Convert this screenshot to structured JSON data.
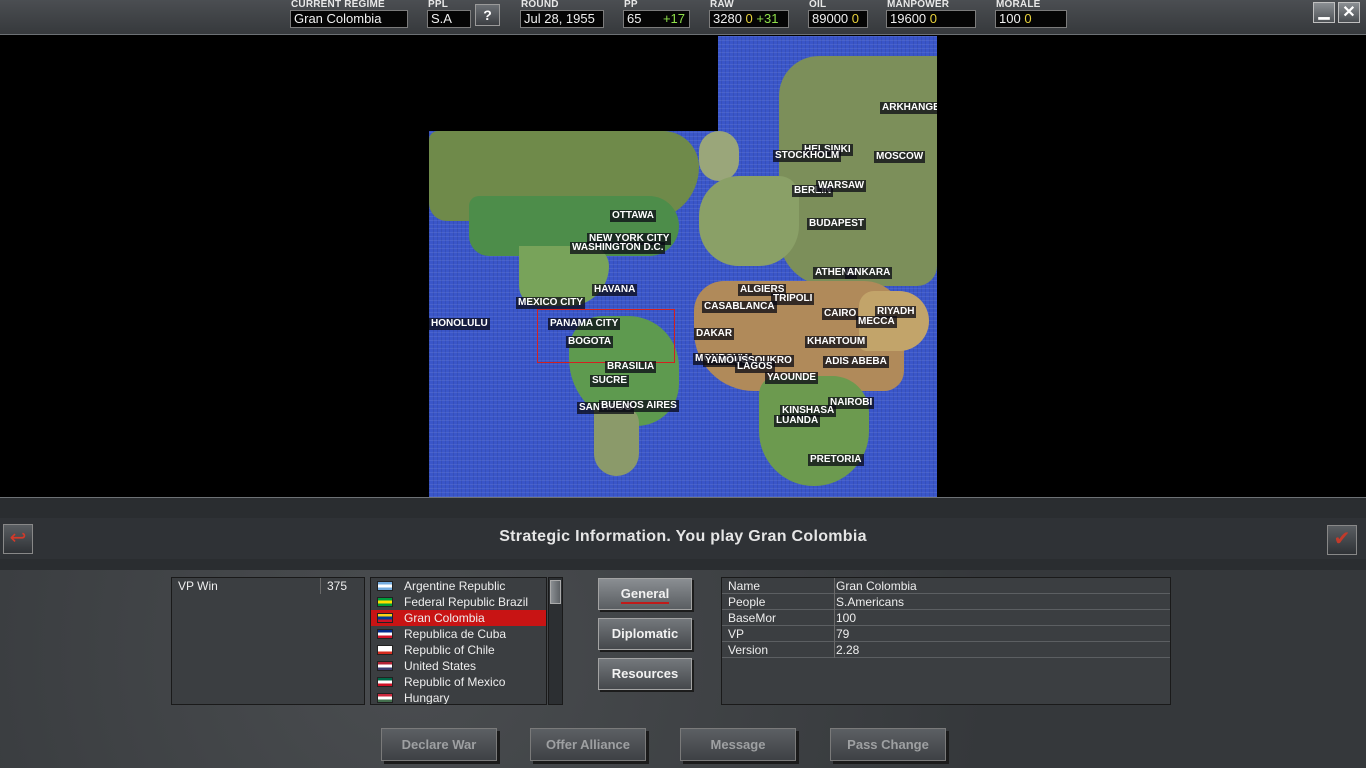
{
  "topbar": {
    "regime_label": "CURRENT REGIME",
    "regime_value": "Gran Colombia",
    "ppl_label": "PPL",
    "ppl_value": "S.A",
    "help_label": "?",
    "round_label": "ROUND",
    "round_value": "Jul 28, 1955",
    "pp_label": "PP",
    "pp_value": "65",
    "pp_delta": "+17",
    "raw_label": "RAW",
    "raw_value": "3280",
    "raw_extra": "0",
    "raw_delta": "+31",
    "oil_label": "OIL",
    "oil_value": "89000",
    "oil_extra": "0",
    "manpower_label": "MANPOWER",
    "manpower_value": "19600",
    "manpower_extra": "0",
    "morale_label": "MORALE",
    "morale_value": "100",
    "morale_extra": "0",
    "minimize_icon": "minimize-icon",
    "close_icon": "close-icon"
  },
  "map": {
    "cities": [
      "ARKHANGELSK",
      "HELSINKI",
      "STOCKHOLM",
      "MOSCOW",
      "BERLIN",
      "WARSAW",
      "BUDAPEST",
      "OTTAWA",
      "NEW YORK CITY",
      "WASHINGTON D.C.",
      "ATHENS",
      "ANKARA",
      "HAVANA",
      "ALGIERS",
      "TRIPOLI",
      "MEXICO CITY",
      "CASABLANCA",
      "CAIRO",
      "RIYADH",
      "HONOLULU",
      "PANAMA CITY",
      "MECCA",
      "DAKAR",
      "BOGOTA",
      "KHARTOUM",
      "MONROVIA",
      "YAMOUSSOUKRO",
      "LAGOS",
      "ADIS ABEBA",
      "BRASILIA",
      "YAOUNDE",
      "SUCRE",
      "NAIROBI",
      "SANTIAGO",
      "BUENOS AIRES",
      "KINSHASA",
      "LUANDA",
      "PRETORIA"
    ]
  },
  "banner": {
    "title": "Strategic Information. You play Gran Colombia",
    "back_icon": "undo-arrow-icon",
    "ok_icon": "checkmark-icon"
  },
  "vp": {
    "label": "VP Win",
    "value": "375"
  },
  "regimes": [
    {
      "name": "Argentine Republic",
      "flag": [
        "#74acdf",
        "#ffffff",
        "#74acdf"
      ]
    },
    {
      "name": "Federal Republic Brazil",
      "flag": [
        "#009c3b",
        "#ffdf00",
        "#009c3b"
      ]
    },
    {
      "name": "Gran Colombia",
      "flag": [
        "#fcd116",
        "#003893",
        "#ce1126"
      ],
      "selected": true
    },
    {
      "name": "Republica de Cuba",
      "flag": [
        "#002a8f",
        "#ffffff",
        "#cf142b"
      ]
    },
    {
      "name": "Republic of Chile",
      "flag": [
        "#ffffff",
        "#ffffff",
        "#d52b1e"
      ]
    },
    {
      "name": "United States",
      "flag": [
        "#b22234",
        "#ffffff",
        "#3c3b6e"
      ]
    },
    {
      "name": "Republic of Mexico",
      "flag": [
        "#006847",
        "#ffffff",
        "#ce1126"
      ]
    },
    {
      "name": "Hungary",
      "flag": [
        "#cd2a3e",
        "#ffffff",
        "#436f4d"
      ]
    }
  ],
  "tabs": {
    "general": "General",
    "diplomatic": "Diplomatic",
    "resources": "Resources"
  },
  "info": [
    {
      "key": "Name",
      "value": "Gran Colombia"
    },
    {
      "key": "People",
      "value": "S.Americans"
    },
    {
      "key": "BaseMor",
      "value": "100"
    },
    {
      "key": "VP",
      "value": "79"
    },
    {
      "key": "Version",
      "value": "2.28"
    }
  ],
  "actions": {
    "declare_war": "Declare War",
    "offer_alliance": "Offer Alliance",
    "message": "Message",
    "pass_change": "Pass Change"
  }
}
